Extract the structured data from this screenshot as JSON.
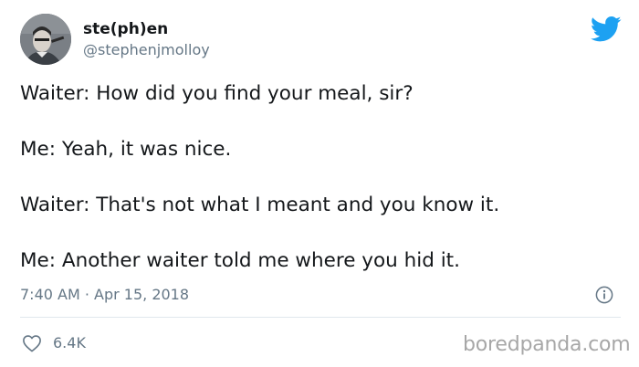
{
  "author": {
    "display_name": "ste(ph)en",
    "handle": "@stephenjmolloy"
  },
  "tweet": {
    "lines": [
      "Waiter: How did you find your meal, sir?",
      "Me: Yeah, it was nice.",
      "Waiter: That's not what I meant and you know it.",
      "Me: Another waiter told me where you hid it."
    ],
    "timestamp": "7:40 AM · Apr 15, 2018",
    "like_count": "6.4K"
  },
  "icons": {
    "platform": "twitter-bird-icon",
    "info": "info-icon",
    "like": "heart-icon"
  },
  "colors": {
    "twitter_blue": "#1da1f2",
    "text": "#14171a",
    "muted": "#657786",
    "divider": "#e1e8ed",
    "watermark": "#a7a7a7"
  },
  "watermark": "boredpanda.com"
}
